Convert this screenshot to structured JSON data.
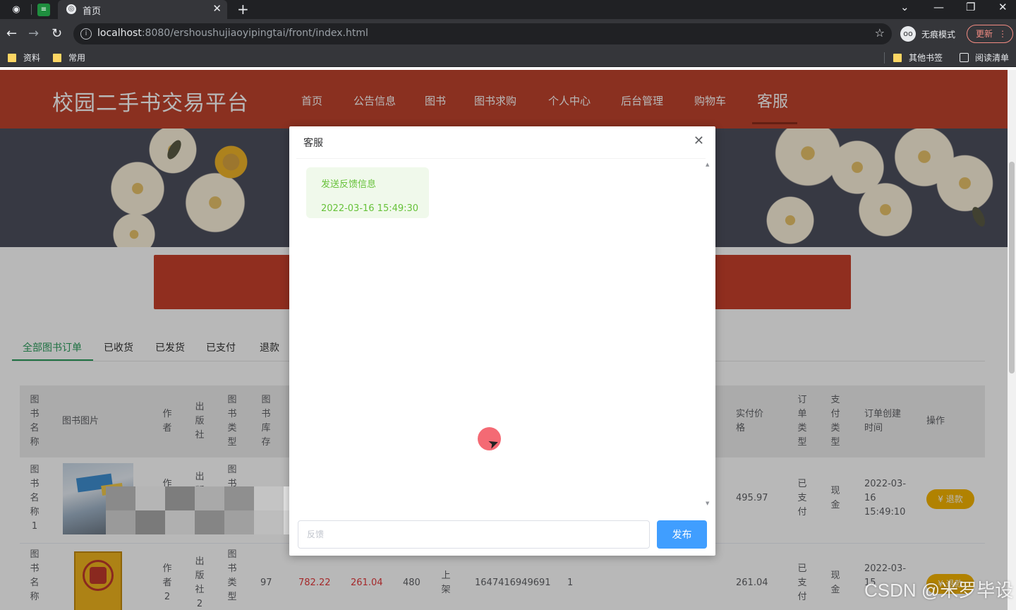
{
  "browser": {
    "tab_title": "首页",
    "url_host": "localhost",
    "url_rest": ":8080/ershoushujiaoyipingtai/front/index.html",
    "incognito_label": "无痕模式",
    "update_label": "更新",
    "bookmarks": [
      "资料",
      "常用"
    ],
    "bookmarks_right": [
      "其他书签",
      "阅读清单"
    ]
  },
  "site": {
    "title": "校园二手书交易平台",
    "nav": [
      "首页",
      "公告信息",
      "图书",
      "图书求购",
      "个人中心",
      "后台管理",
      "购物车",
      "客服"
    ],
    "active_nav": "客服"
  },
  "orders": {
    "tabs": [
      "全部图书订单",
      "已收货",
      "已发货",
      "已支付",
      "退款"
    ],
    "active_tab": "全部图书订单",
    "headers": {
      "name": "图书名称",
      "image": "图书图片",
      "author": "作者",
      "publisher": "出版社",
      "type": "图书类型",
      "stock": "图书库存",
      "paid_price": "实付价格",
      "order_type": "订单类型",
      "pay_type": "支付类型",
      "created": "订单创建时间",
      "action": "操作"
    },
    "rows": [
      {
        "name": "图书名称1",
        "author": "作",
        "publisher": "出版",
        "type": "图书",
        "paid_price": "495.97",
        "order_type": "已支付",
        "pay_type": "现金",
        "created": [
          "2022-03-",
          "16",
          "15:49:10"
        ],
        "action": "退款"
      },
      {
        "name": "图书名称",
        "author": "作者2",
        "publisher": "出版社2",
        "type": "图书类型",
        "stock": "97",
        "price": "782.22",
        "discount_price": "261.04",
        "points": "480",
        "status": "上架",
        "order_no": "1647416949691",
        "quantity": "1",
        "paid_price": "261.04",
        "order_type": "已支付",
        "pay_type": "现金",
        "created": [
          "2022-03-",
          "15"
        ],
        "action": "退款"
      }
    ]
  },
  "dialog": {
    "title": "客服",
    "messages": [
      {
        "text": "发送反馈信息",
        "time": "2022-03-16 15:49:30"
      }
    ],
    "input_placeholder": "反馈",
    "publish_label": "发布"
  },
  "watermark": "CSDN @米罗毕设",
  "colors": {
    "header_red": "#c0432d",
    "accent_green": "#2a9d5c",
    "bubble_bg": "#f0f9eb",
    "bubble_text": "#67c23a",
    "primary_blue": "#409eff",
    "refund_yellow": "#f5b400"
  }
}
